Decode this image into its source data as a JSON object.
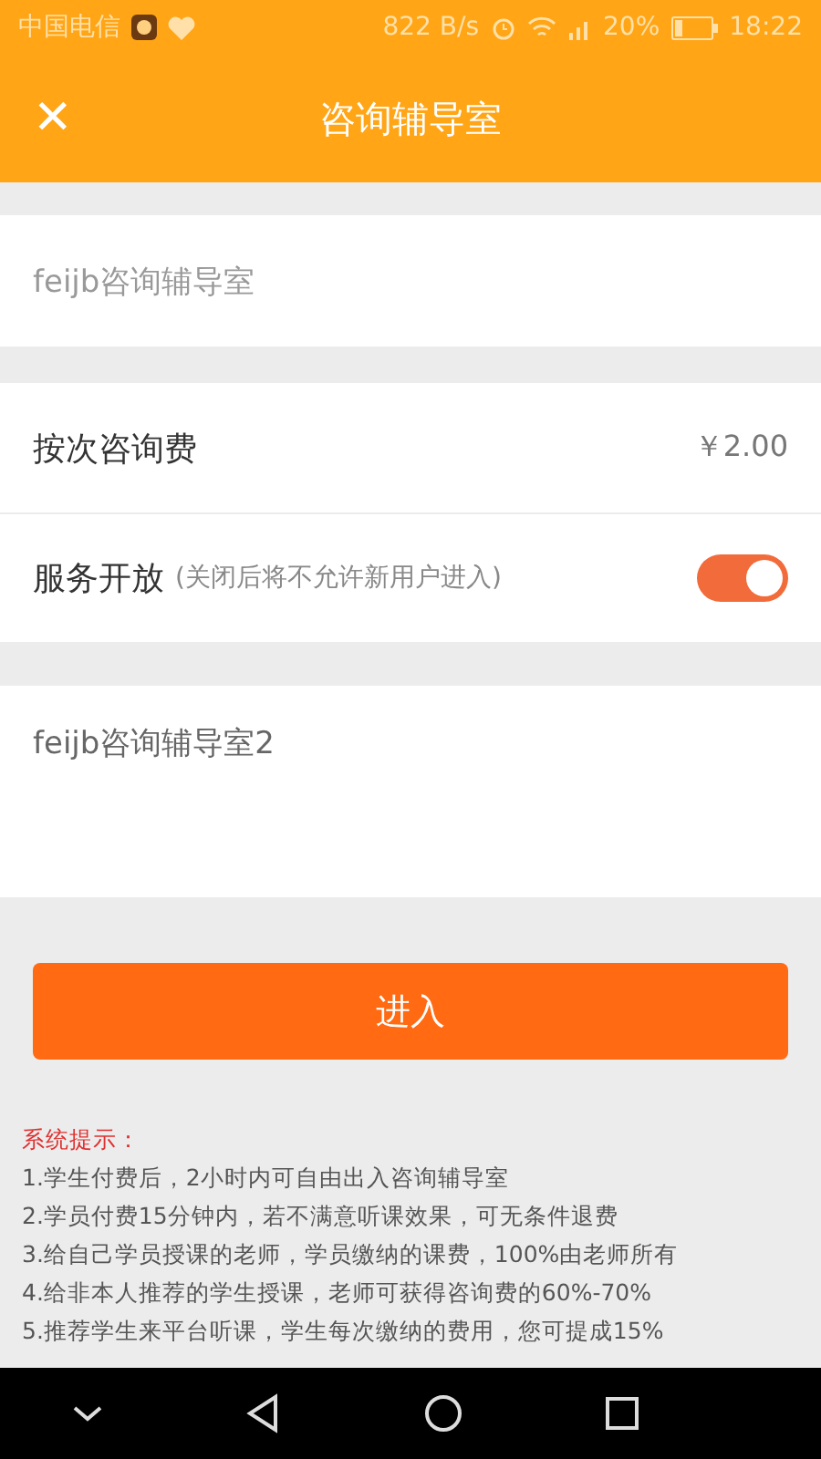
{
  "status_bar": {
    "carrier": "中国电信",
    "speed": "822 B/s",
    "battery": "20%",
    "time": "18:22"
  },
  "header": {
    "close": "✕",
    "title": "咨询辅导室"
  },
  "name_field": {
    "value": "feijb咨询辅导室"
  },
  "fee": {
    "label": "按次咨询费",
    "value": "￥2.00"
  },
  "service": {
    "label": "服务开放",
    "hint": "(关闭后将不允许新用户进入)",
    "on": true
  },
  "description": {
    "value": "feijb咨询辅导室2"
  },
  "enter_button": "进入",
  "notes": {
    "title": "系统提示：",
    "items": [
      "1.学生付费后，2小时内可自由出入咨询辅导室",
      "2.学员付费15分钟内，若不满意听课效果，可无条件退费",
      "3.给自己学员授课的老师，学员缴纳的课费，100%由老师所有",
      "4.给非本人推荐的学生授课，老师可获得咨询费的60%-70%",
      "5.推荐学生来平台听课，学生每次缴纳的费用，您可提成15%"
    ]
  }
}
